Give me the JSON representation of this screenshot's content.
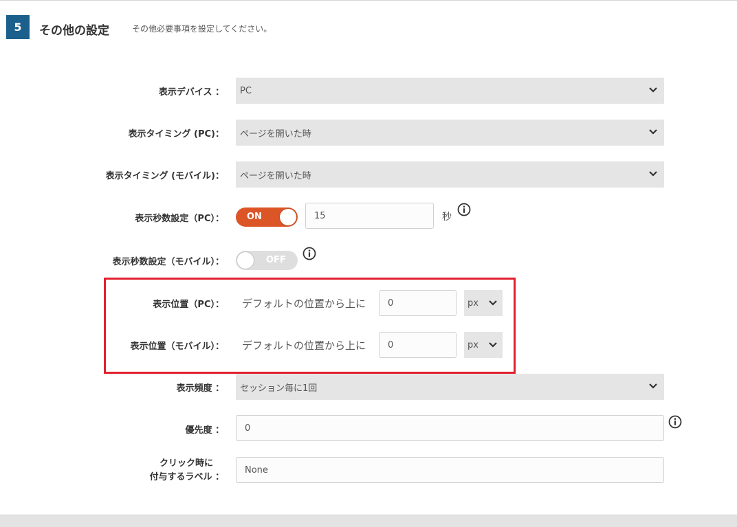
{
  "section": {
    "number": "5",
    "title": "その他の設定",
    "description": "その他必要事項を設定してください。"
  },
  "fields": {
    "display_device": {
      "label": "表示デバイス ：",
      "value": "PC"
    },
    "timing_pc": {
      "label": "表示タイミング (PC)：",
      "value": "ページを開いた時"
    },
    "timing_mobile": {
      "label": "表示タイミング (モバイル)：",
      "value": "ページを開いた時"
    },
    "seconds_pc": {
      "label": "表示秒数設定（PC）：",
      "toggle": "ON",
      "value": "15",
      "unit": "秒"
    },
    "seconds_mobile": {
      "label": "表示秒数設定（モバイル）：",
      "toggle": "OFF"
    },
    "position_pc": {
      "label": "表示位置（PC）：",
      "text": "デフォルトの位置から上に",
      "value": "0",
      "unit": "px"
    },
    "position_mobile": {
      "label": "表示位置（モバイル）：",
      "text": "デフォルトの位置から上に",
      "value": "0",
      "unit": "px"
    },
    "frequency": {
      "label": "表示頻度 ：",
      "value": "セッション毎に1回"
    },
    "priority": {
      "label": "優先度 ：",
      "value": "0"
    },
    "click_label": {
      "label_line1": "クリック時に",
      "label_line2": "付与するラベル ：",
      "value": "None"
    }
  },
  "colors": {
    "badge": "#1b5f8c",
    "toggle_on": "#dc5527",
    "toggle_off": "#dedede",
    "highlight_box": "#e0202e"
  },
  "icons": {
    "dropdown": "chevron-down-icon",
    "info": "info-icon"
  }
}
